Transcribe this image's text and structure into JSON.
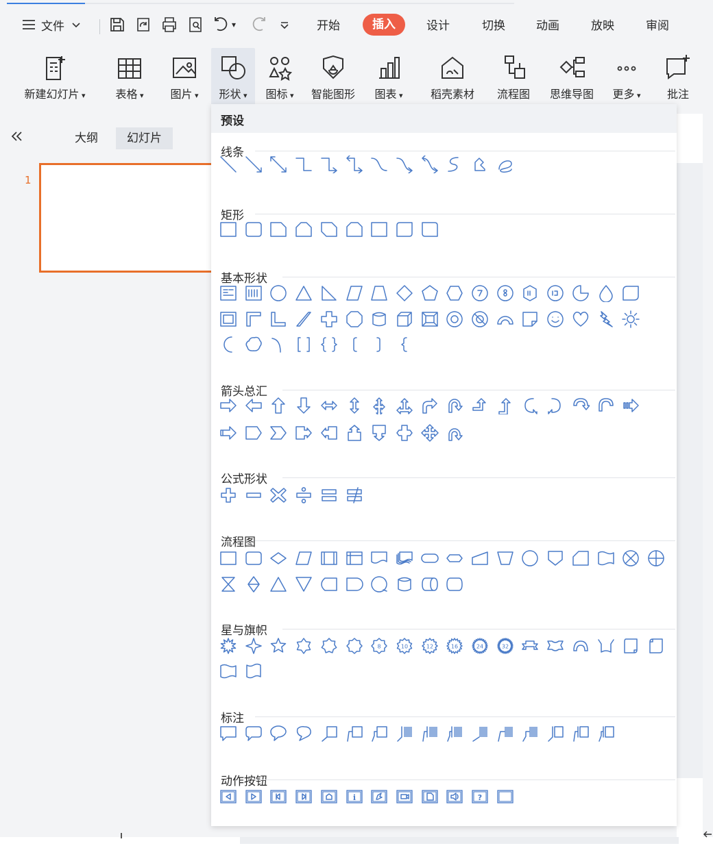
{
  "menubar": {
    "file_label": "文件",
    "tabs": [
      {
        "label": "开始",
        "active": false
      },
      {
        "label": "插入",
        "active": true
      },
      {
        "label": "设计",
        "active": false
      },
      {
        "label": "切换",
        "active": false
      },
      {
        "label": "动画",
        "active": false
      },
      {
        "label": "放映",
        "active": false
      },
      {
        "label": "审阅",
        "active": false
      }
    ]
  },
  "ribbon": {
    "items": [
      {
        "label": "新建幻灯片",
        "icon": "new-slide-icon",
        "dropdown": true
      },
      {
        "label": "表格",
        "icon": "table-icon",
        "dropdown": true
      },
      {
        "label": "图片",
        "icon": "picture-icon",
        "dropdown": true
      },
      {
        "label": "形状",
        "icon": "shapes-icon",
        "dropdown": true,
        "selected": true
      },
      {
        "label": "图标",
        "icon": "icons-icon",
        "dropdown": true
      },
      {
        "label": "智能图形",
        "icon": "smartart-icon",
        "dropdown": false
      },
      {
        "label": "图表",
        "icon": "chart-icon",
        "dropdown": true
      },
      {
        "label": "稻壳素材",
        "icon": "docer-assets-icon",
        "dropdown": false
      },
      {
        "label": "流程图",
        "icon": "flowchart-icon",
        "dropdown": false
      },
      {
        "label": "思维导图",
        "icon": "mindmap-icon",
        "dropdown": false
      },
      {
        "label": "更多",
        "icon": "more-icon",
        "dropdown": true
      },
      {
        "label": "批注",
        "icon": "comment-icon",
        "dropdown": false
      }
    ]
  },
  "left_panel": {
    "tabs": [
      {
        "label": "大纲",
        "active": false
      },
      {
        "label": "幻灯片",
        "active": true
      }
    ],
    "slide_number": "1"
  },
  "shapes_menu": {
    "preset_label": "预设",
    "sections": [
      {
        "title": "线条",
        "count": 12
      },
      {
        "title": "矩形",
        "count": 9
      },
      {
        "title": "基本形状",
        "count": 42
      },
      {
        "title": "箭头总汇",
        "count": 28
      },
      {
        "title": "公式形状",
        "count": 6
      },
      {
        "title": "流程图",
        "count": 28
      },
      {
        "title": "星与旗帜",
        "count": 20
      },
      {
        "title": "标注",
        "count": 16
      },
      {
        "title": "动作按钮",
        "count": 12
      }
    ]
  },
  "colors": {
    "accent": "#ee5e47",
    "shape_stroke": "#4a7bc8",
    "slide_border": "#e86f2a",
    "progress": "#3b7fe0"
  }
}
